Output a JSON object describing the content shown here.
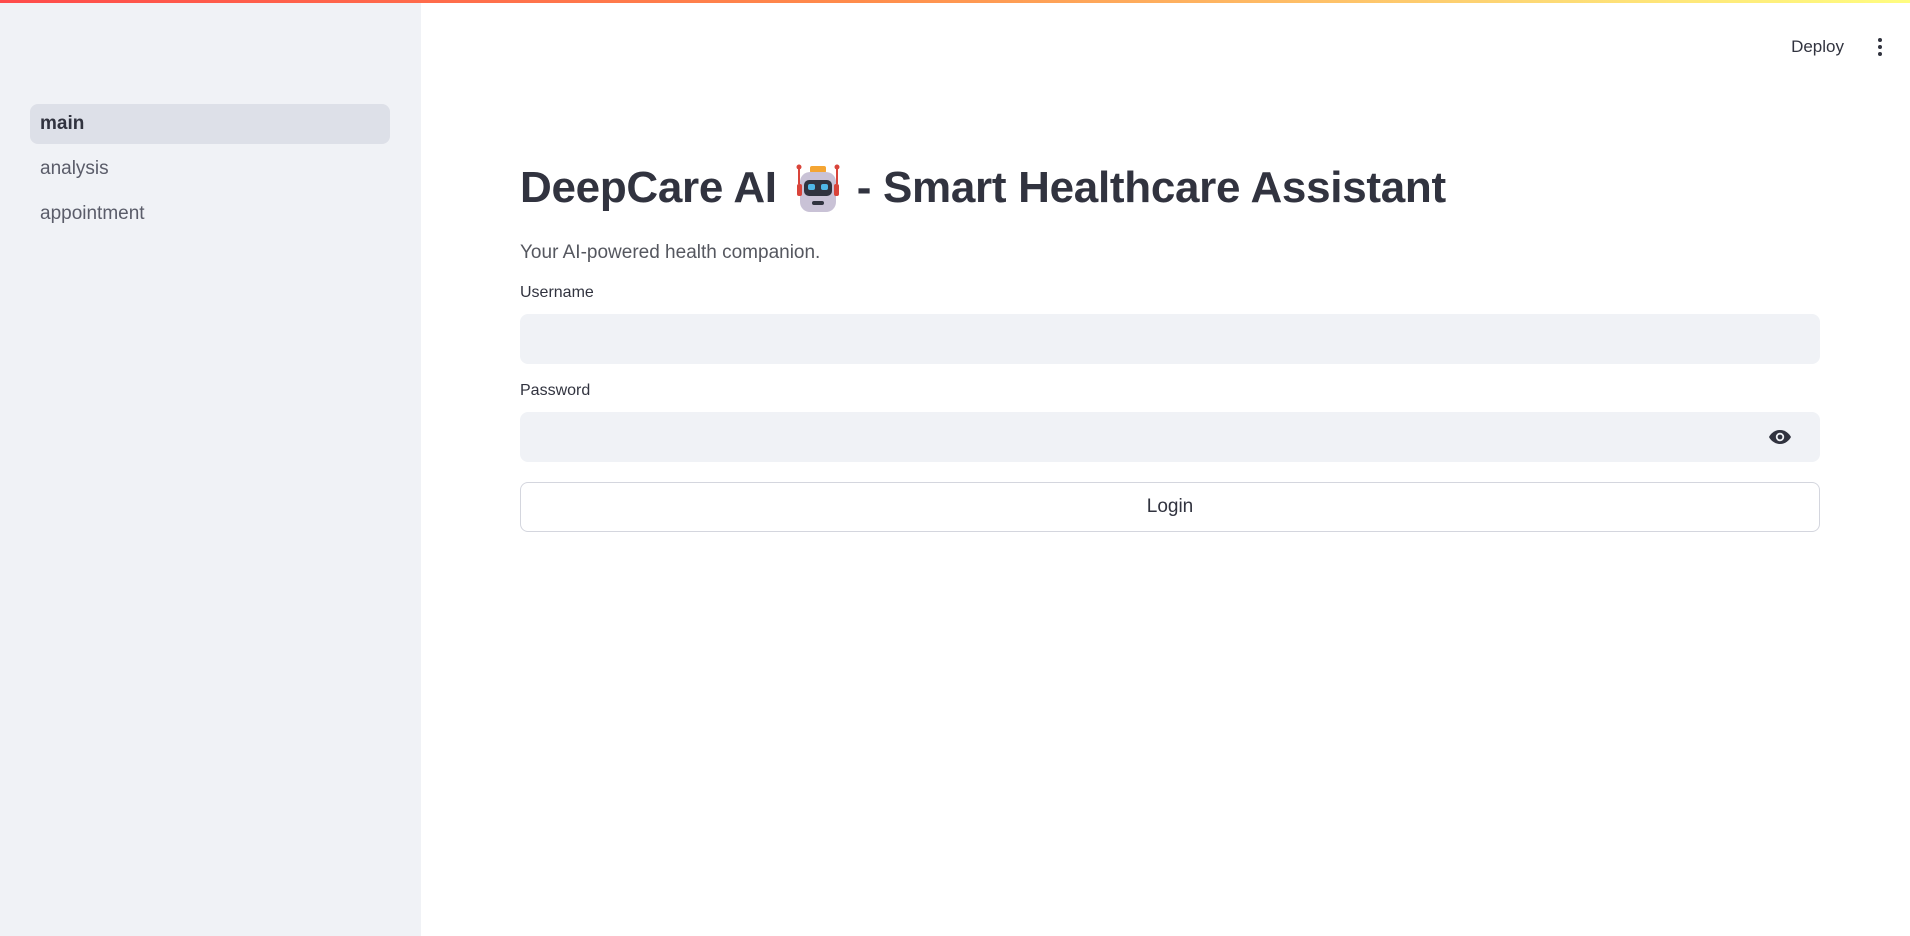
{
  "sidebar": {
    "items": [
      {
        "label": "main",
        "active": true
      },
      {
        "label": "analysis",
        "active": false
      },
      {
        "label": "appointment",
        "active": false
      }
    ]
  },
  "header": {
    "deploy_label": "Deploy",
    "menu_icon": "more-vertical-icon"
  },
  "main": {
    "title_before": "DeepCare AI",
    "title_emoji": "robot-icon",
    "title_after": "- Smart Healthcare Assistant",
    "subtitle": "Your AI-powered health companion.",
    "username": {
      "label": "Username",
      "value": ""
    },
    "password": {
      "label": "Password",
      "value": "",
      "toggle_icon": "eye-icon"
    },
    "login_label": "Login"
  },
  "colors": {
    "sidebar_bg": "#f0f2f6",
    "active_nav_bg": "#dde0e8",
    "text": "#31333f",
    "input_bg": "#f0f2f6",
    "accent_gradient_start": "#ff4b4b",
    "accent_gradient_end": "#fffd80"
  }
}
